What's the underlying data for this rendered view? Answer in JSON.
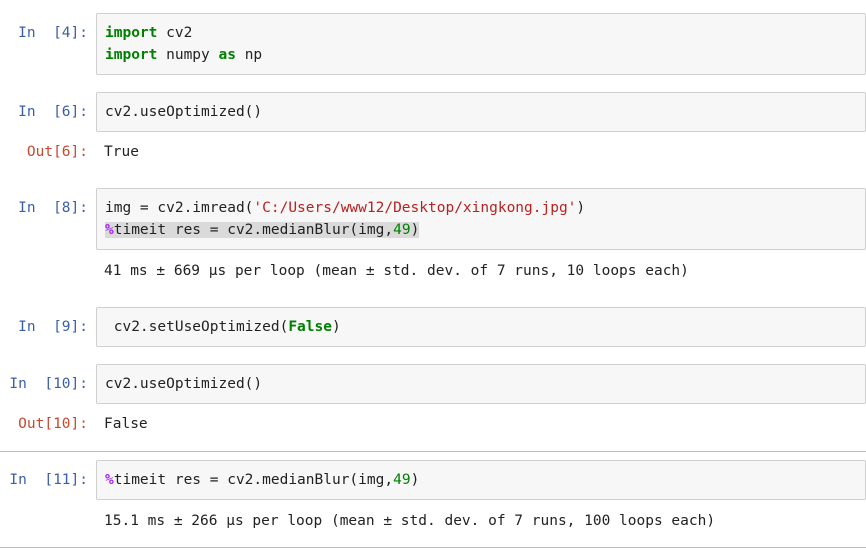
{
  "cells": [
    {
      "in_prompt": "In  [4]:",
      "code": {
        "line1": {
          "kw": "import",
          "rest": " cv2"
        },
        "line2": {
          "kw1": "import",
          "mid": " numpy ",
          "kw2": "as",
          "rest": " np"
        }
      }
    },
    {
      "in_prompt": "In  [6]:",
      "code": {
        "text": "cv2.useOptimized()"
      },
      "out_prompt": "Out[6]:",
      "output": "True"
    },
    {
      "in_prompt": "In  [8]:",
      "code": {
        "line1": {
          "pre": "img = cv2.imread(",
          "str": "'C:/Users/www12/Desktop/xingkong.jpg'",
          "post": ")"
        },
        "line2": {
          "magic": "%",
          "mid": "timeit res = cv2.medianBlur(img,",
          "num": "49",
          "post": ")"
        }
      },
      "output": "41 ms ± 669 µs per loop (mean ± std. dev. of 7 runs, 10 loops each)"
    },
    {
      "in_prompt": "In  [9]:",
      "code": {
        "pre": " cv2.setUseOptimized(",
        "kw": "False",
        "post": ")"
      }
    },
    {
      "in_prompt": "In  [10]:",
      "code": {
        "text": "cv2.useOptimized()"
      },
      "out_prompt": "Out[10]:",
      "output": "False"
    },
    {
      "in_prompt": "In  [11]:",
      "code": {
        "magic": "%",
        "mid": "timeit res = cv2.medianBlur(img,",
        "num": "49",
        "post": ")"
      },
      "output": "15.1 ms ± 266 µs per loop (mean ± std. dev. of 7 runs, 100 loops each)"
    }
  ],
  "colors": {
    "in_prompt": "#3b5ea8",
    "out_prompt": "#c9482f",
    "keyword": "#008000",
    "magic": "#aa22ff",
    "string": "#ba2121",
    "input_bg": "#f7f7f7"
  }
}
